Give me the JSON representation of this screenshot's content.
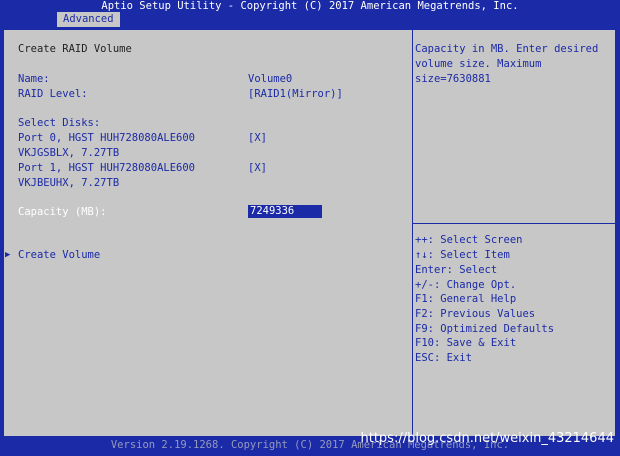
{
  "title": "Aptio Setup Utility - Copyright (C) 2017 American Megatrends, Inc.",
  "tab": "Advanced",
  "main": {
    "heading": "Create RAID Volume",
    "name_label": "Name:",
    "name_value": "Volume0",
    "raid_label": "RAID Level:",
    "raid_value": "[RAID1(Mirror)]",
    "select_disks_label": "Select Disks:",
    "disks": [
      {
        "line1": "Port 0, HGST HUH728080ALE600",
        "line2": "VKJGSBLX, 7.27TB",
        "checked": "[X]"
      },
      {
        "line1": "Port 1, HGST HUH728080ALE600",
        "line2": "VKJBEUHX, 7.27TB",
        "checked": "[X]"
      }
    ],
    "capacity_label": "Capacity (MB):",
    "capacity_value": "7249336",
    "create_volume": "Create Volume"
  },
  "help": {
    "line1": "Capacity in MB. Enter desired",
    "line2": "volume size. Maximum",
    "line3": "size=7630881"
  },
  "keys": [
    "++: Select Screen",
    "↑↓: Select Item",
    "Enter: Select",
    "+/-: Change Opt.",
    "F1: General Help",
    "F2: Previous Values",
    "F9: Optimized Defaults",
    "F10: Save & Exit",
    "ESC: Exit"
  ],
  "footer": "Version 2.19.1268. Copyright (C) 2017 American Megatrends, Inc.",
  "watermark": "https://blog.csdn.net/weixin_43214644",
  "colors": {
    "background": "#1b2aa6",
    "panel": "#c7c7c7",
    "highlight": "#1b2aa6"
  }
}
